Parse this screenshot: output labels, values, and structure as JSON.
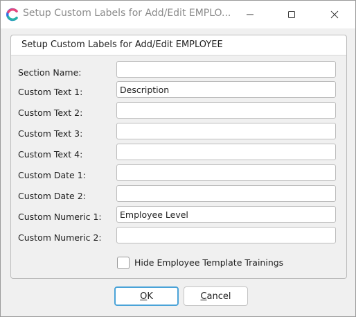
{
  "window": {
    "title": "Setup Custom Labels for Add/Edit EMPLO...",
    "icon": "app-logo-icon",
    "controls": [
      "minimize-icon",
      "maximize-icon",
      "close-icon"
    ]
  },
  "group": {
    "title": "Setup Custom Labels for Add/Edit EMPLOYEE"
  },
  "fields": [
    {
      "label": "Section Name:",
      "value": ""
    },
    {
      "label": "Custom Text 1:",
      "value": "Description"
    },
    {
      "label": "Custom Text 2:",
      "value": ""
    },
    {
      "label": "Custom Text 3:",
      "value": ""
    },
    {
      "label": "Custom Text 4:",
      "value": ""
    },
    {
      "label": "Custom Date 1:",
      "value": ""
    },
    {
      "label": "Custom Date 2:",
      "value": ""
    },
    {
      "label": "Custom Numeric 1:",
      "value": "Employee Level"
    },
    {
      "label": "Custom Numeric 2:",
      "value": ""
    }
  ],
  "checkbox": {
    "label": "Hide Employee Template Trainings",
    "checked": false
  },
  "buttons": {
    "ok_first": "O",
    "ok_rest": "K",
    "cancel_first": "C",
    "cancel_rest": "ancel"
  },
  "colors": {
    "accent_border": "#4aa3d8",
    "logo_blue": "#2f6fe4",
    "logo_pink": "#e8457a"
  }
}
